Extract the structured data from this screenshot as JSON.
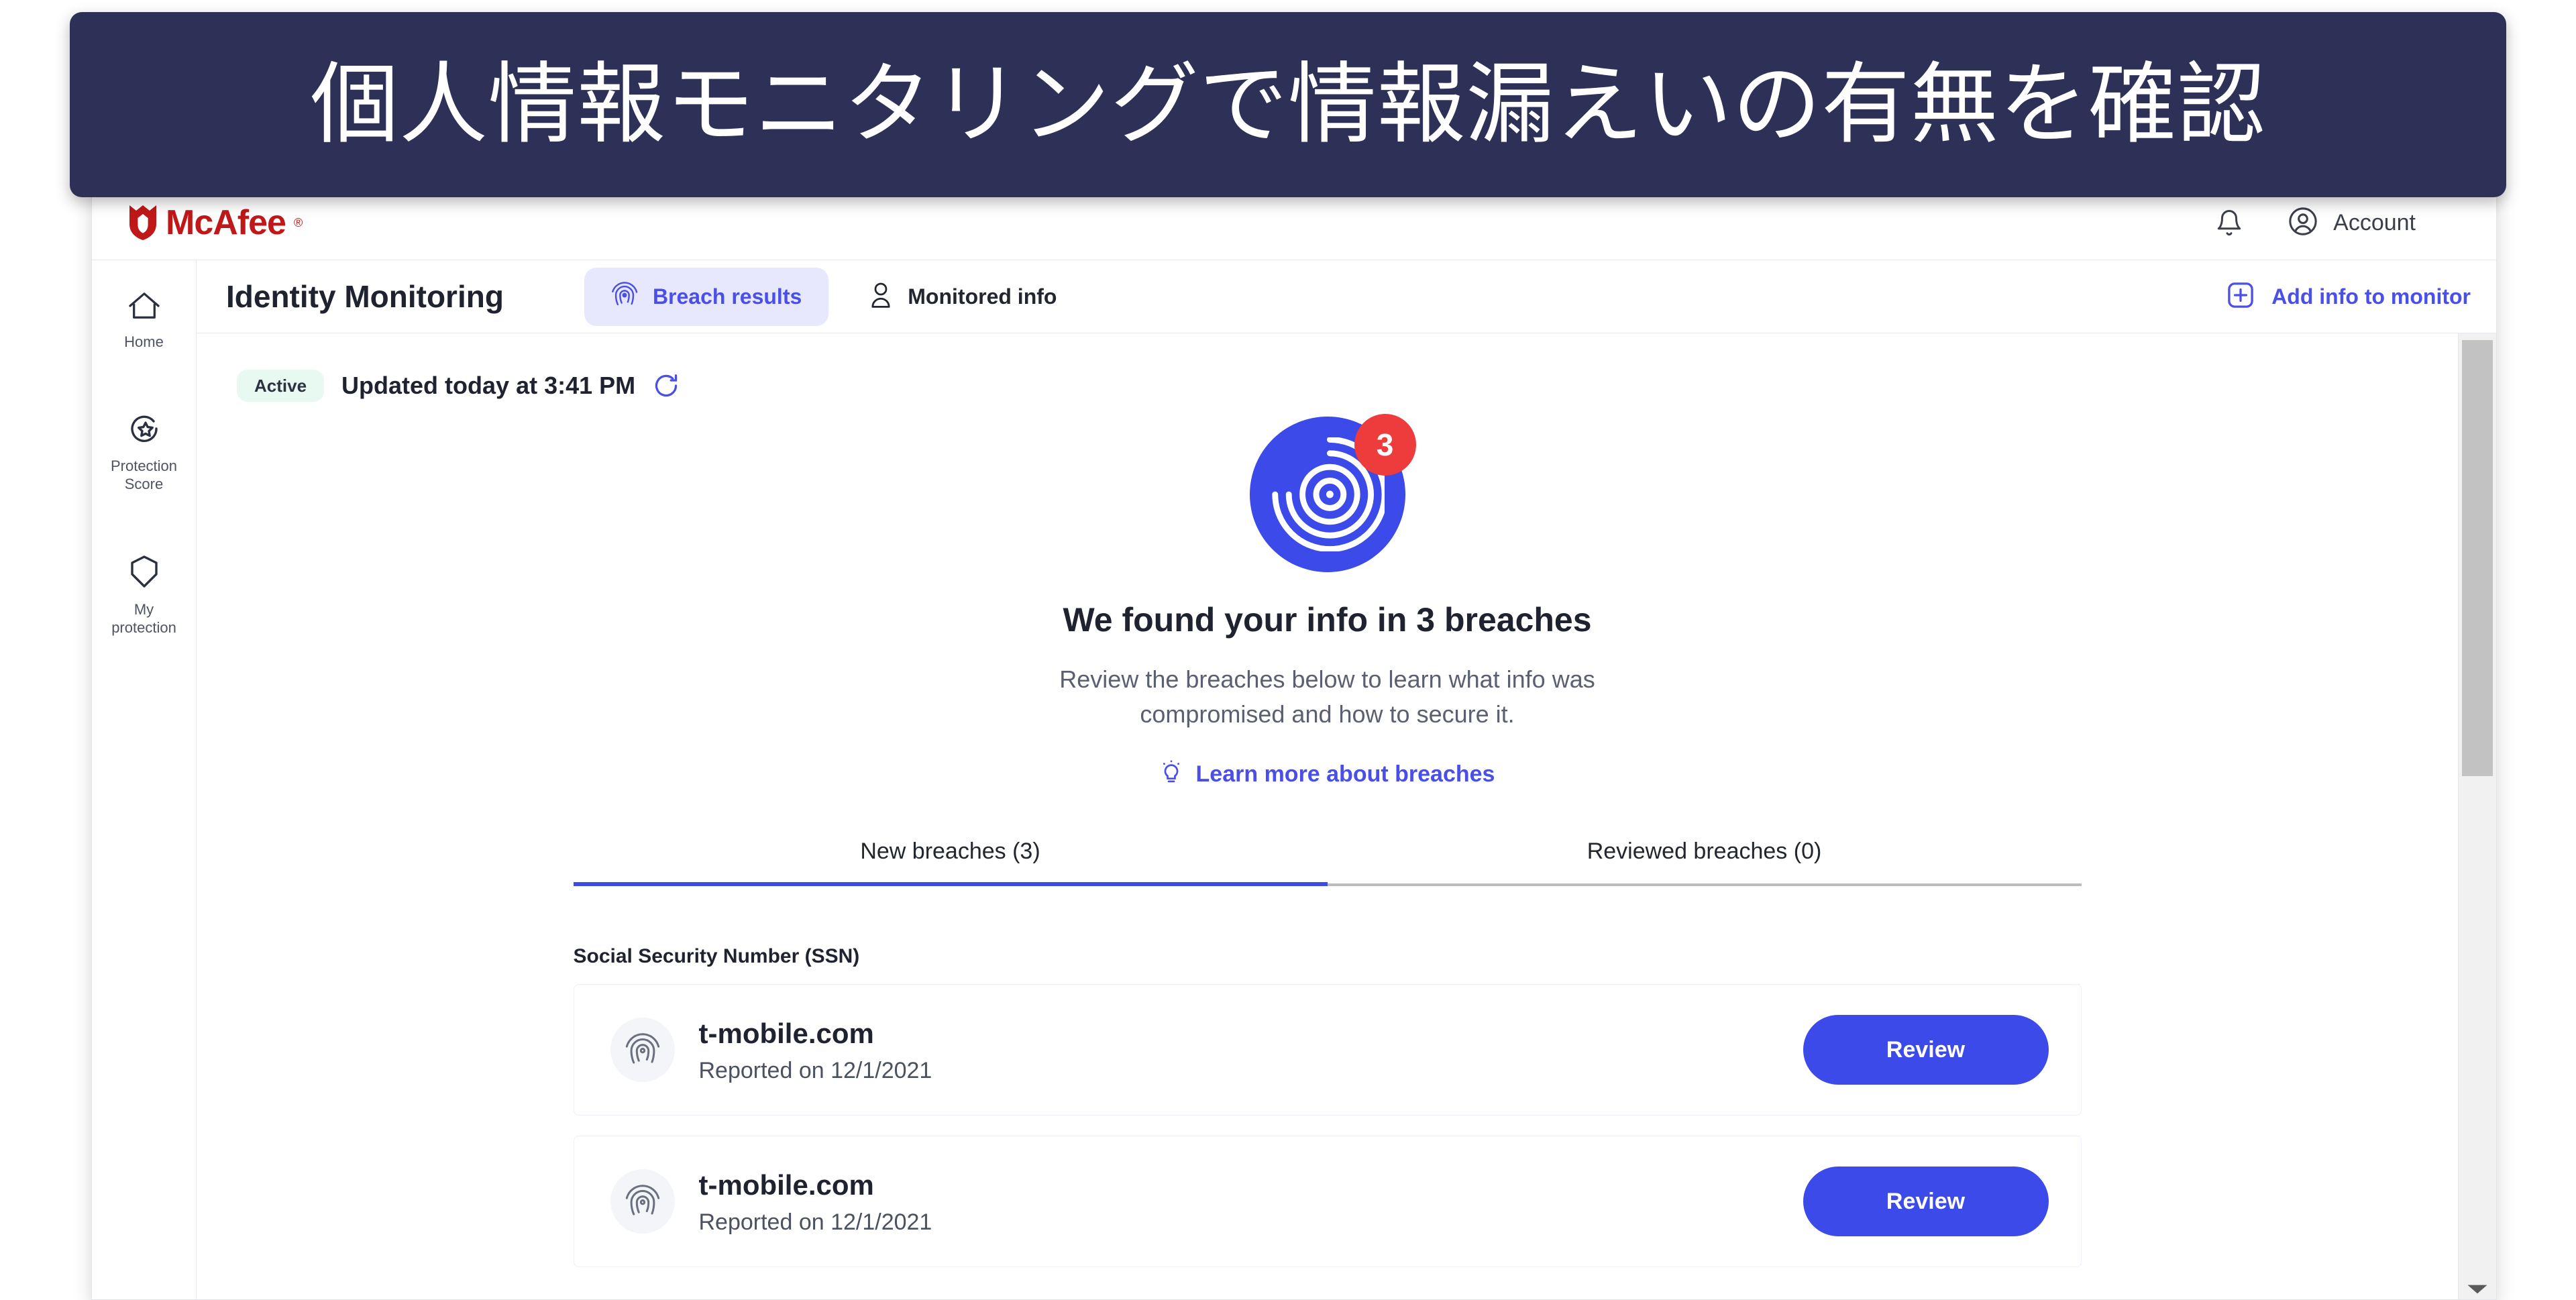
{
  "banner": {
    "text": "個人情報モニタリングで情報漏えいの有無を確認",
    "bg_color": "#2e3157",
    "text_color": "#ffffff"
  },
  "brand": {
    "name": "McAfee",
    "registered_mark": "®",
    "color": "#c01818"
  },
  "topbar": {
    "notifications_icon": "bell-icon",
    "account_icon": "account-avatar-icon",
    "account_label": "Account"
  },
  "sidebar": {
    "items": [
      {
        "icon": "home-icon",
        "label": "Home"
      },
      {
        "icon": "protection-score-icon",
        "label": "Protection\nScore"
      },
      {
        "icon": "shield-icon",
        "label": "My\nprotection"
      }
    ]
  },
  "page_header": {
    "title": "Identity Monitoring",
    "tabs": [
      {
        "label": "Breach results",
        "icon": "fingerprint-icon",
        "active": true
      },
      {
        "label": "Monitored info",
        "icon": "person-icon",
        "active": false
      }
    ],
    "action": {
      "label": "Add info to monitor",
      "icon": "plus-square-icon"
    }
  },
  "status": {
    "badge": "Active",
    "badge_bg": "#e7f9f0",
    "updated_text": "Updated today at 3:41 PM",
    "refresh_icon": "refresh-icon"
  },
  "hero": {
    "fingerprint_icon": "fingerprint-icon",
    "badge_count": "3",
    "badge_color": "#ee3b3b",
    "circle_color": "#3b4ae8",
    "headline": "We found your info in 3 breaches",
    "subtext": "Review the breaches below to learn what info was compromised and how to secure it.",
    "link_label": "Learn more about breaches",
    "link_icon": "lightbulb-icon",
    "accent_color": "#4a4fe8"
  },
  "breach_tabs": [
    {
      "label": "New breaches (3)",
      "active": true
    },
    {
      "label": "Reviewed breaches (0)",
      "active": false
    }
  ],
  "sections": [
    {
      "title": "Social Security Number (SSN)",
      "cards": [
        {
          "icon": "fingerprint-icon",
          "domain": "t-mobile.com",
          "reported": "Reported on 12/1/2021",
          "button": "Review"
        },
        {
          "icon": "fingerprint-icon",
          "domain": "t-mobile.com",
          "reported": "Reported on 12/1/2021",
          "button": "Review"
        }
      ]
    }
  ],
  "scrollbar": {
    "down_arrow_icon": "chevron-down-icon"
  }
}
